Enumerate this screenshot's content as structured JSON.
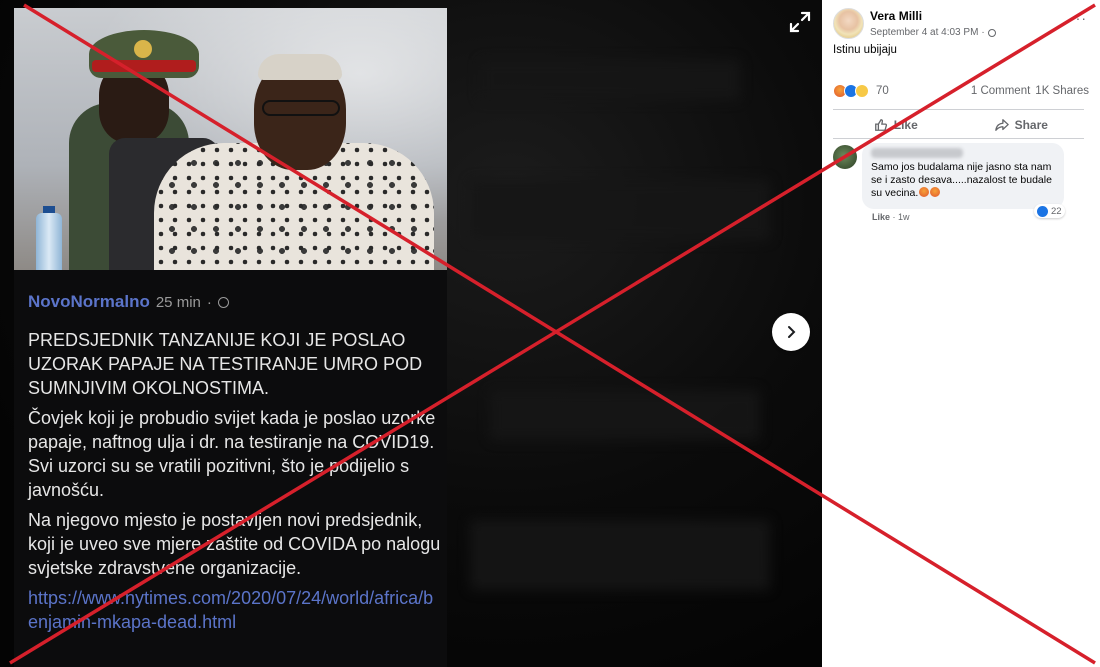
{
  "viewer": {
    "post": {
      "author": "NovoNormalno",
      "time": "25 min",
      "separator": "·",
      "paragraphs": [
        "PREDSJEDNIK TANZANIJE KOJI JE POSLAO UZORAK PAPAJE NA TESTIRANJE UMRO POD SUMNJIVIM OKOLNOSTIMA.",
        "Čovjek koji je probudio svijet kada je poslao uzorke papaje, naftnog ulja i dr. na testiranje na COVID19. Svi uzorci su se vratili pozitivni, što je podijelio s javnošću.",
        "Na njegovo mjesto je postavljen novi predsjednik, koji je uveo sve mjere zaštite od COVIDA po nalogu svjetske zdravstvene organizacije."
      ],
      "link": "https://www.nytimes.com/2020/07/24/world/africa/benjamin-mkapa-dead.html"
    }
  },
  "sidebar": {
    "author_name": "Vera Milli",
    "timestamp": "September 4 at 4:03 PM",
    "meta_separator": "·",
    "caption": "Istinu ubijaju",
    "reaction_count": "70",
    "comments_count": "1 Comment",
    "shares_count": "1K Shares",
    "like_label": "Like",
    "share_label": "Share",
    "comment": {
      "text": "Samo jos budalama nije jasno sta nam se i zasto desava.....nazalost te budale su vecina.",
      "like_label": "Like",
      "separator": "·",
      "age": "1w",
      "reaction_count": "22"
    }
  },
  "colors": {
    "overlay_x": "#d6202b",
    "link": "#5b74c9",
    "facebook_blue": "#1b74e4"
  }
}
